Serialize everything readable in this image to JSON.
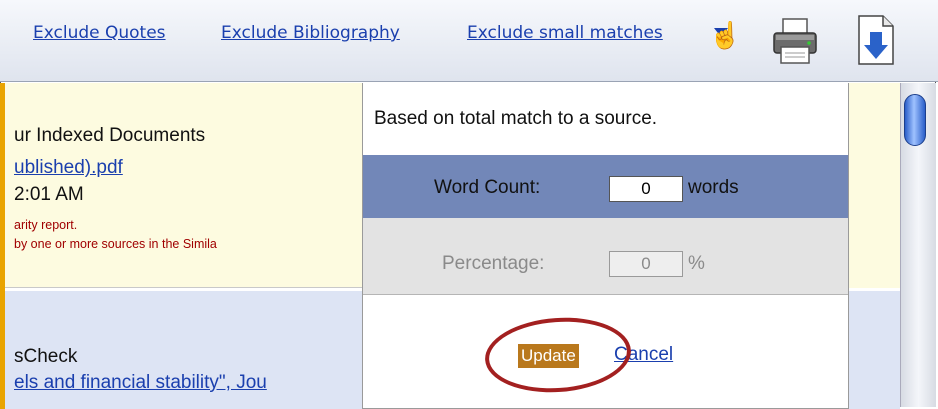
{
  "toolbar": {
    "links": [
      "Exclude Quotes",
      "Exclude Bibliography",
      "Exclude small matches"
    ],
    "icons": [
      "printer-icon",
      "download-icon",
      "dropdown-arrow-icon",
      "hand-cursor-icon"
    ]
  },
  "document": {
    "title_fragment": "ur Indexed Documents",
    "file_link_fragment": "ublished).pdf ",
    "time_fragment": "2:01 AM",
    "note_line1": "arity report.",
    "note_line2": "by one or more sources in the Simila",
    "check_fragment": "sCheck",
    "source_link_fragment": "els and financial stability\", Jou"
  },
  "popup": {
    "heading": "Based on total match to a source.",
    "word_count_label": "Word Count:",
    "word_count_value": "0",
    "word_count_unit": "words",
    "percentage_label": "Percentage:",
    "percentage_value": "0",
    "percentage_unit": "%",
    "update_label": "Update",
    "cancel_label": "Cancel"
  },
  "colors": {
    "link": "#1a3fae",
    "word_row": "#7287b8",
    "update_button": "#b9781c",
    "highlight_ring": "#a32020"
  }
}
